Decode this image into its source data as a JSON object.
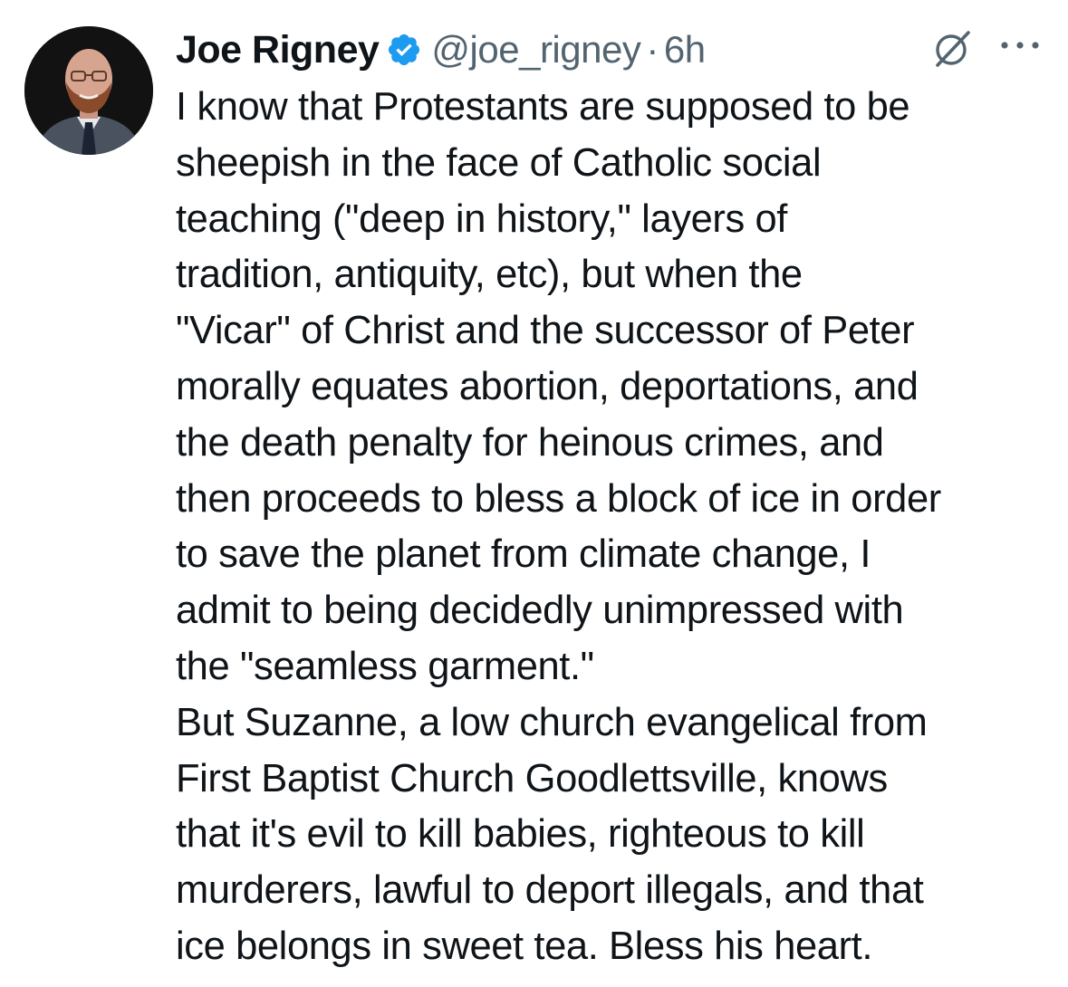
{
  "author": {
    "name": "Joe Rigney",
    "handle": "@joe_rigney",
    "separator": "·",
    "time": "6h",
    "verified_icon": "verified-badge-icon",
    "verified_color": "#1d9bf0"
  },
  "icons": {
    "grok": "grok-icon",
    "more": "more-options-icon"
  },
  "tweet": {
    "lines": [
      "I know that Protestants are supposed to be",
      "sheepish in the face of Catholic social",
      "teaching (\"deep in history,\" layers of",
      "tradition, antiquity, etc), but when the",
      "\"Vicar\" of Christ and the successor of Peter",
      "morally equates abortion, deportations, and",
      "the death penalty for heinous crimes, and",
      "then proceeds to bless a block of ice in order",
      "to save the planet from climate change, I",
      "admit to being decidedly unimpressed with",
      "the \"seamless garment.\"",
      "But Suzanne, a low church evangelical from",
      "First Baptist Church Goodlettsville, knows",
      "that it's evil to kill babies, righteous to kill",
      "murderers, lawful to deport illegals, and that",
      "ice belongs in sweet tea. Bless his heart."
    ]
  },
  "colors": {
    "text": "#0f1419",
    "secondary": "#536471",
    "background": "#ffffff"
  }
}
